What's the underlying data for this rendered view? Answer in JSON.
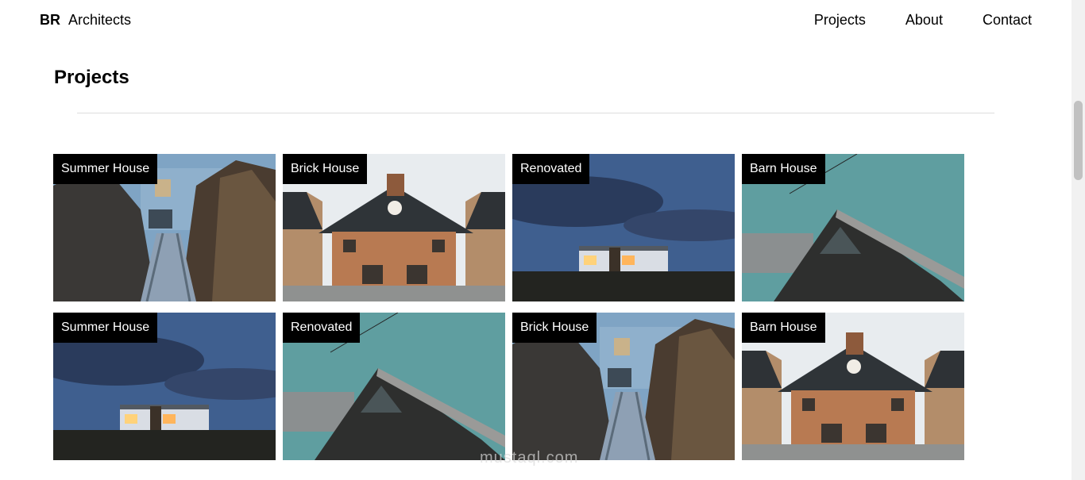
{
  "brand": {
    "short": "BR",
    "name": "Architects"
  },
  "nav": {
    "items": [
      "Projects",
      "About",
      "Contact"
    ]
  },
  "page": {
    "heading": "Projects"
  },
  "projects": [
    {
      "label": "Summer House",
      "photo": "house-reeds-photo"
    },
    {
      "label": "Brick House",
      "photo": "brick-house-photo"
    },
    {
      "label": "Renovated",
      "photo": "house-dusk-photo"
    },
    {
      "label": "Barn House",
      "photo": "barn-house-photo"
    },
    {
      "label": "Summer House",
      "photo": "house-dusk-photo"
    },
    {
      "label": "Renovated",
      "photo": "barn-house-photo"
    },
    {
      "label": "Brick House",
      "photo": "house-reeds-photo"
    },
    {
      "label": "Barn House",
      "photo": "brick-house-photo"
    }
  ],
  "watermark": {
    "text": "mustaql.com"
  },
  "colors": {
    "label_bg": "#000000",
    "label_text": "#ffffff",
    "divider": "#dddddd"
  }
}
